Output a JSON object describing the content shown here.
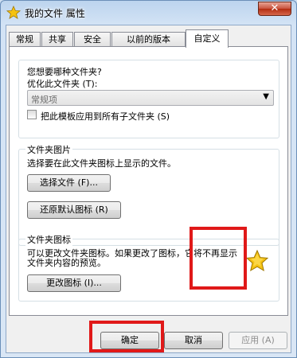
{
  "window": {
    "title": "我的文件 属性",
    "close_label": "✕"
  },
  "tabs": [
    {
      "label": "常规"
    },
    {
      "label": "共享"
    },
    {
      "label": "安全"
    },
    {
      "label": "以前的版本"
    },
    {
      "label": "自定义",
      "active": true
    }
  ],
  "optimize": {
    "question": "您想要哪种文件夹?",
    "label": "优化此文件夹 (T):",
    "selected": "常规项",
    "apply_all_label": "把此模板应用到所有子文件夹 (S)",
    "apply_all_checked": false
  },
  "picture": {
    "title": "文件夹图片",
    "description": "选择要在此文件夹图标上显示的文件。",
    "choose_button": "选择文件 (F)...",
    "restore_button": "还原默认图标 (R)"
  },
  "icon": {
    "title": "文件夹图标",
    "description_line1": "可以更改文件夹图标。如果更改了图标，它将不再显示",
    "description_line2": "文件夹内容的预览。",
    "change_button": "更改图标 (I)...",
    "preview_icon": "star-icon"
  },
  "footer": {
    "ok": "确定",
    "cancel": "取消",
    "apply": "应用 (A)"
  },
  "colors": {
    "highlight": "#e01919",
    "star": "#f5c211"
  }
}
